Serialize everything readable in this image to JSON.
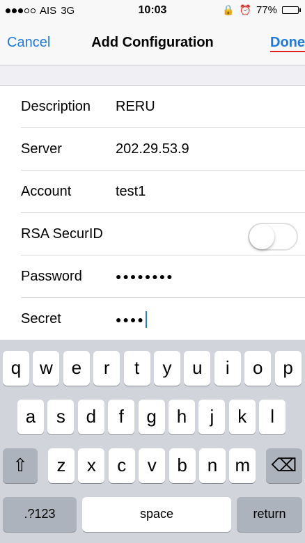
{
  "status_bar": {
    "carrier": "AIS",
    "network": "3G",
    "time": "10:03",
    "battery": "77%",
    "battery_level": 0.77,
    "signal_strength": 3,
    "signal_total": 5,
    "icons": [
      "lock-rotation-icon",
      "alarm-icon"
    ]
  },
  "nav": {
    "cancel": "Cancel",
    "title": "Add Configuration",
    "done": "Done"
  },
  "form": {
    "description": {
      "label": "Description",
      "value": "RERU"
    },
    "server": {
      "label": "Server",
      "value": "202.29.53.9"
    },
    "account": {
      "label": "Account",
      "value": "test1"
    },
    "rsa": {
      "label": "RSA SecurID",
      "enabled": false
    },
    "password": {
      "label": "Password",
      "value": "●●●●●●●●"
    },
    "secret": {
      "label": "Secret",
      "value": "●●●●"
    }
  },
  "keyboard": {
    "row1": [
      "q",
      "w",
      "e",
      "r",
      "t",
      "y",
      "u",
      "i",
      "o",
      "p"
    ],
    "row2": [
      "a",
      "s",
      "d",
      "f",
      "g",
      "h",
      "j",
      "k",
      "l"
    ],
    "row3": [
      "z",
      "x",
      "c",
      "v",
      "b",
      "n",
      "m"
    ],
    "shift_icon": "⇧",
    "delete_icon": "⌫",
    "numbers": ".?123",
    "space": "space",
    "return": "return"
  },
  "colors": {
    "accent": "#1f7ae0",
    "done_underline": "#e02020"
  }
}
